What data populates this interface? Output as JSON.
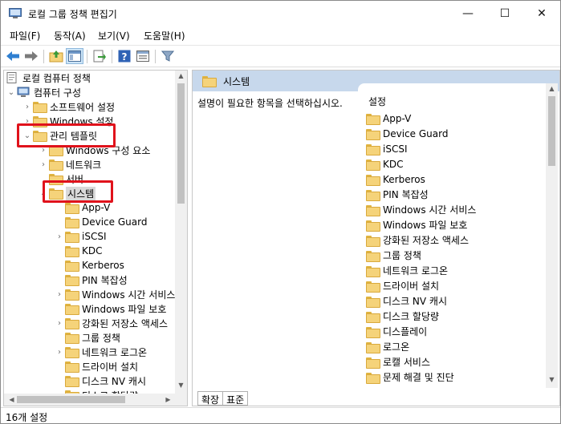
{
  "window": {
    "title": "로컬 그룹 정책 편집기"
  },
  "controls": {
    "minimize": "—",
    "maximize": "☐",
    "close": "✕"
  },
  "menu": [
    "파일(F)",
    "동작(A)",
    "보기(V)",
    "도움말(H)"
  ],
  "tree": {
    "root": "로컬 컴퓨터 정책",
    "computer_config": "컴퓨터 구성",
    "software_settings": "소프트웨어 설정",
    "windows_settings": "Windows 설정",
    "admin_templates": "관리 템플릿",
    "windows_components": "Windows 구성 요소",
    "network": "네트워크",
    "server": "서버",
    "system": "시스템",
    "children": [
      "App-V",
      "Device Guard",
      "iSCSI",
      "KDC",
      "Kerberos",
      "PIN 복잡성",
      "Windows 시간 서비스",
      "Windows 파일 보호",
      "강화된 저장소 액세스",
      "그룹 정책",
      "네트워크 로그온",
      "드라이버 설치",
      "디스크 NV 캐시",
      "디스크 할당량"
    ]
  },
  "right": {
    "header": "시스템",
    "description": "설명이 필요한 항목을 선택하십시오.",
    "column_header": "설정",
    "items": [
      "App-V",
      "Device Guard",
      "iSCSI",
      "KDC",
      "Kerberos",
      "PIN 복잡성",
      "Windows 시간 서비스",
      "Windows 파일 보호",
      "강화된 저장소 액세스",
      "그룹 정책",
      "네트워크 로그온",
      "드라이버 설치",
      "디스크 NV 캐시",
      "디스크 할당량",
      "디스플레이",
      "로그온",
      "로캘 서비스",
      "문제 해결 및 진단"
    ],
    "tabs": [
      "확장",
      "표준"
    ]
  },
  "status": {
    "text": "16개 설정"
  },
  "colors": {
    "highlight_box": "#e0121b",
    "header_bg": "#c7d8ec",
    "folder": "#f5d37a"
  }
}
